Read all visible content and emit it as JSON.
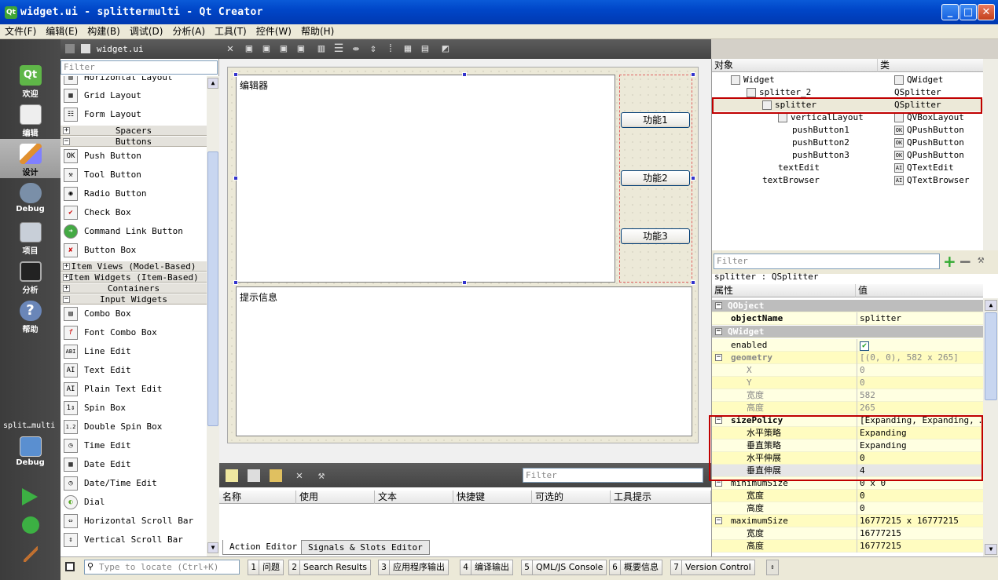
{
  "window": {
    "title": "widget.ui - splittermulti - Qt Creator",
    "app_icon": "Qt",
    "min_glyph": "_",
    "max_glyph": "□",
    "close_glyph": "✕"
  },
  "menubar": [
    "文件(F)",
    "编辑(E)",
    "构建(B)",
    "调试(D)",
    "分析(A)",
    "工具(T)",
    "控件(W)",
    "帮助(H)"
  ],
  "modebar": {
    "modes": [
      {
        "label": "欢迎",
        "icon": "qt-logo-icon"
      },
      {
        "label": "编辑",
        "icon": "edit-document-icon"
      },
      {
        "label": "设计",
        "icon": "design-brush-icon"
      },
      {
        "label": "Debug",
        "icon": "debug-bug-icon"
      },
      {
        "label": "项目",
        "icon": "project-icon"
      },
      {
        "label": "分析",
        "icon": "analyze-icon"
      },
      {
        "label": "帮助",
        "icon": "help-icon"
      }
    ],
    "project_label": "split…multi",
    "project_mode": "Debug"
  },
  "widgetbox": {
    "file_tab": "widget.ui",
    "filter_placeholder": "Filter",
    "layouts": [
      {
        "label": "Horizontal Layout",
        "icon": "▥"
      },
      {
        "label": "Grid Layout",
        "icon": "▦"
      },
      {
        "label": "Form Layout",
        "icon": "☷"
      }
    ],
    "cat_spacers": "Spacers",
    "cat_buttons": "Buttons",
    "buttons": [
      {
        "label": "Push Button",
        "icon": "OK"
      },
      {
        "label": "Tool Button",
        "icon": "⚒"
      },
      {
        "label": "Radio Button",
        "icon": "◉"
      },
      {
        "label": "Check Box",
        "icon": "✔"
      },
      {
        "label": "Command Link Button",
        "icon": "➜"
      },
      {
        "label": "Button Box",
        "icon": "✘"
      }
    ],
    "cat_item_views": "Item Views (Model-Based)",
    "cat_item_widgets": "Item Widgets (Item-Based)",
    "cat_containers": "Containers",
    "cat_input": "Input Widgets",
    "inputs": [
      {
        "label": "Combo Box",
        "icon": "▤"
      },
      {
        "label": "Font Combo Box",
        "icon": "f"
      },
      {
        "label": "Line Edit",
        "icon": "ABI"
      },
      {
        "label": "Text Edit",
        "icon": "AI"
      },
      {
        "label": "Plain Text Edit",
        "icon": "AI"
      },
      {
        "label": "Spin Box",
        "icon": "1⇕"
      },
      {
        "label": "Double Spin Box",
        "icon": "1.2"
      },
      {
        "label": "Time Edit",
        "icon": "◷"
      },
      {
        "label": "Date Edit",
        "icon": "▦"
      },
      {
        "label": "Date/Time Edit",
        "icon": "◷"
      },
      {
        "label": "Dial",
        "icon": "◐"
      },
      {
        "label": "Horizontal Scroll Bar",
        "icon": "⇔"
      },
      {
        "label": "Vertical Scroll Bar",
        "icon": "⇕"
      }
    ]
  },
  "form": {
    "editor_text": "编辑器",
    "info_text": "提示信息",
    "buttons": [
      "功能1",
      "功能2",
      "功能3"
    ]
  },
  "action_editor": {
    "filter_placeholder": "Filter",
    "columns": [
      "名称",
      "使用",
      "文本",
      "快捷键",
      "可选的",
      "工具提示"
    ],
    "tabs": [
      "Action Editor",
      "Signals & Slots Editor"
    ]
  },
  "object_inspector": {
    "col_object": "对象",
    "col_class": "类",
    "rows": [
      {
        "name": "Widget",
        "cls": "QWidget"
      },
      {
        "name": "splitter_2",
        "cls": "QSplitter"
      },
      {
        "name": "splitter",
        "cls": "QSplitter"
      },
      {
        "name": "verticalLayout",
        "cls": "QVBoxLayout"
      },
      {
        "name": "pushButton1",
        "cls": "QPushButton"
      },
      {
        "name": "pushButton2",
        "cls": "QPushButton"
      },
      {
        "name": "pushButton3",
        "cls": "QPushButton"
      },
      {
        "name": "textEdit",
        "cls": "QTextEdit"
      },
      {
        "name": "textBrowser",
        "cls": "QTextBrowser"
      }
    ]
  },
  "property_editor": {
    "filter_placeholder": "Filter",
    "object_label": "splitter : QSplitter",
    "col_prop": "属性",
    "col_val": "值",
    "rows": [
      {
        "name": "QObject",
        "value": ""
      },
      {
        "name": "objectName",
        "value": "splitter"
      },
      {
        "name": "QWidget",
        "value": ""
      },
      {
        "name": "enabled",
        "value": "✔"
      },
      {
        "name": "geometry",
        "value": "[(0, 0), 582 x 265]"
      },
      {
        "name": "X",
        "value": "0"
      },
      {
        "name": "Y",
        "value": "0"
      },
      {
        "name": "宽度",
        "value": "582"
      },
      {
        "name": "高度",
        "value": "265"
      },
      {
        "name": "sizePolicy",
        "value": "[Expanding, Expanding, …"
      },
      {
        "name": "水平策略",
        "value": "Expanding"
      },
      {
        "name": "垂直策略",
        "value": "Expanding"
      },
      {
        "name": "水平伸展",
        "value": "0"
      },
      {
        "name": "垂直伸展",
        "value": "4"
      },
      {
        "name": "minimumSize",
        "value": "0 x 0"
      },
      {
        "name": "宽度",
        "value": "0"
      },
      {
        "name": "高度",
        "value": "0"
      },
      {
        "name": "maximumSize",
        "value": "16777215 x 16777215"
      },
      {
        "name": "宽度",
        "value": "16777215"
      },
      {
        "name": "高度",
        "value": "16777215"
      }
    ]
  },
  "statusbar": {
    "locate_placeholder": "Type to locate (Ctrl+K)",
    "panes": [
      {
        "n": "1",
        "label": "问题"
      },
      {
        "n": "2",
        "label": "Search Results"
      },
      {
        "n": "3",
        "label": "应用程序输出"
      },
      {
        "n": "4",
        "label": "编译输出"
      },
      {
        "n": "5",
        "label": "QML/JS Console"
      },
      {
        "n": "6",
        "label": "概要信息"
      },
      {
        "n": "7",
        "label": "Version Control"
      }
    ]
  }
}
